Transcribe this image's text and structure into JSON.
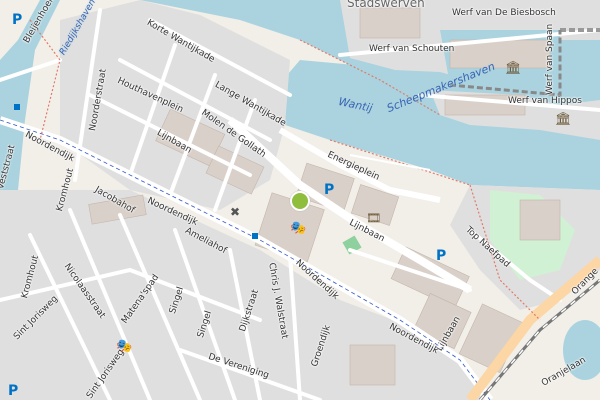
{
  "map": {
    "colors": {
      "water": "#aad3df",
      "land": "#f2efe9",
      "residential": "#e0dfdf",
      "building": "#d9d0c9",
      "road": "#ffffff",
      "primary_road": "#fcd6a4",
      "railway": "#777777",
      "park": "#c8facc",
      "parking_blue": "#0072c6"
    },
    "labels": {
      "stadswerven": "Stadswerven",
      "wantij": "Wantij",
      "scheepmakershaven": "Scheepmakershaven",
      "werf_van_de_biesbosch": "Werf van De Biesbosch",
      "werf_van_schouten": "Werf van Schouten",
      "werf_van_spaan": "Werf van Spaan",
      "werf_van_hippos": "Werf van Hippos",
      "korte_wantijkade": "Korte Wantijkade",
      "lange_wantijkade": "Lange Wantijkade",
      "houthavenplein": "Houthavenplein",
      "molen_de_gollath": "Molen de Gollath",
      "lijnbaan_1": "Lijnbaan",
      "lijnbaan_2": "Lijnbaan",
      "lijnbaan_3": "Lijnbaan",
      "noorderstraat": "Noorderstraat",
      "energieplein": "Energieplein",
      "noordendijk_1": "Noordendijk",
      "noordendijk_2": "Noordendijk",
      "noordendijk_3": "Noordendijk",
      "noordendijk_4": "Noordendijk",
      "jacobahof": "Jacobahof",
      "ameliahof": "Ameliahof",
      "kromhout_1": "Kromhout",
      "kromhout_2": "Kromhout",
      "nicolaasstraat": "Nicolaasstraat",
      "matenapad": "Matena'spad",
      "singel_1": "Singel",
      "singel_2": "Singel",
      "dijkstraat": "Dijkstraat",
      "chris_j_walstraat": "Chris J. Walstraat",
      "groendijk": "Groendijk",
      "sint_jorisweg_1": "Sint Jorisweg",
      "sint_jorisweg_2": "Sint Jorisweg",
      "de_vereniging": "De Vereniging",
      "top_naefpad": "Top Naefpad",
      "bleijenhoek": "Bleijenhoek",
      "riedijkshaven": "Riedijkshaven",
      "veststraat": "Veststraat",
      "oranjelaan": "Oranjelaan",
      "oranje": "Orange",
      "parking": "P"
    },
    "icons": {
      "theatre": "theatre-masks-icon",
      "cinema": "cinema-film-icon",
      "museum": "museum-icon",
      "windmill": "windmill-icon",
      "bus_stop": "bus-stop-icon",
      "marker": "map-marker-icon"
    }
  }
}
